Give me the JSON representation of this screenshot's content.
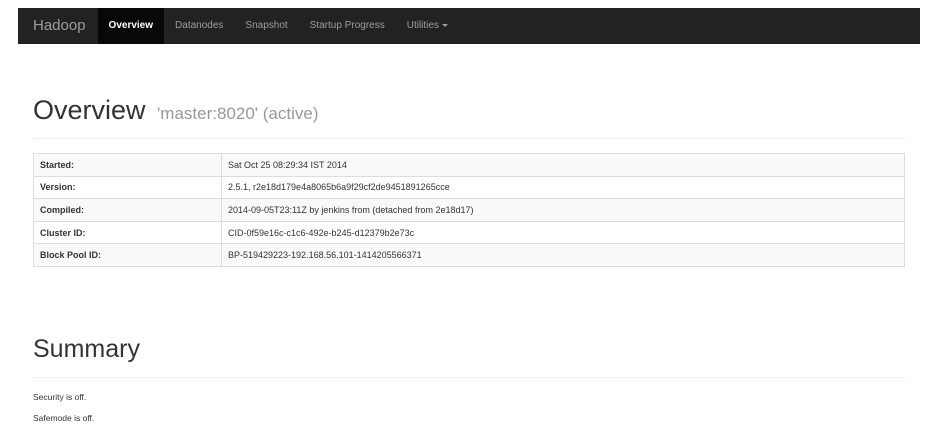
{
  "navbar": {
    "brand": "Hadoop",
    "items": [
      {
        "label": "Overview"
      },
      {
        "label": "Datanodes"
      },
      {
        "label": "Snapshot"
      },
      {
        "label": "Startup Progress"
      },
      {
        "label": "Utilities"
      }
    ]
  },
  "overview": {
    "title": "Overview",
    "subtitle": "'master:8020' (active)",
    "rows": [
      {
        "key": "Started:",
        "value": "Sat Oct 25 08:29:34 IST 2014"
      },
      {
        "key": "Version:",
        "value": "2.5.1, r2e18d179e4a8065b6a9f29cf2de9451891265cce"
      },
      {
        "key": "Compiled:",
        "value": "2014-09-05T23:11Z by jenkins from (detached from 2e18d17)"
      },
      {
        "key": "Cluster ID:",
        "value": "CID-0f59e16c-c1c6-492e-b245-d12379b2e73c"
      },
      {
        "key": "Block Pool ID:",
        "value": "BP-519429223-192.168.56.101-1414205566371"
      }
    ]
  },
  "summary": {
    "title": "Summary",
    "lines": [
      "Security is off.",
      "Safemode is off."
    ]
  },
  "colors": {
    "navbar_bg": "#222222",
    "nav_active_bg": "#080808",
    "nav_text": "#9d9d9d",
    "text": "#333333",
    "muted": "#999999",
    "table_stripe": "#f9f9f9",
    "border": "#dddddd"
  }
}
